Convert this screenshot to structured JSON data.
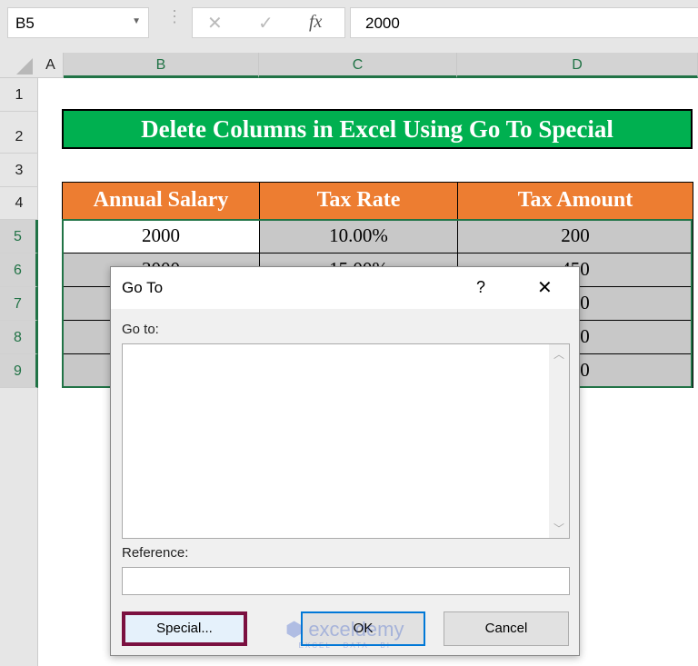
{
  "formula_bar": {
    "name_box": "B5",
    "cancel_icon": "✕",
    "enter_icon": "✓",
    "fx_label": "fx",
    "formula": "2000"
  },
  "columns": [
    "A",
    "B",
    "C",
    "D"
  ],
  "rows": [
    "1",
    "2",
    "3",
    "4",
    "5",
    "6",
    "7",
    "8",
    "9"
  ],
  "sheet": {
    "title": "Delete Columns in Excel Using Go To Special",
    "headers": [
      "Annual Salary",
      "Tax Rate",
      "Tax Amount"
    ],
    "data": [
      [
        "2000",
        "10.00%",
        "200"
      ],
      [
        "3000",
        "15.00%",
        "450"
      ],
      [
        "",
        "",
        "350"
      ],
      [
        "",
        "",
        "400"
      ],
      [
        "",
        "",
        "500"
      ]
    ]
  },
  "dialog": {
    "title": "Go To",
    "help": "?",
    "close": "✕",
    "goto_label": "Go to:",
    "reference_label": "Reference:",
    "reference_value": "",
    "buttons": {
      "special": "Special...",
      "ok": "OK",
      "cancel": "Cancel"
    }
  },
  "watermark": {
    "brand": "exceldemy",
    "tagline": "EXCEL · DATA · BI"
  },
  "colors": {
    "title_bg": "#00b050",
    "header_bg": "#ed7d31",
    "selection": "#217346",
    "special_highlight": "#7b1040",
    "ok_focus": "#0078d7"
  }
}
